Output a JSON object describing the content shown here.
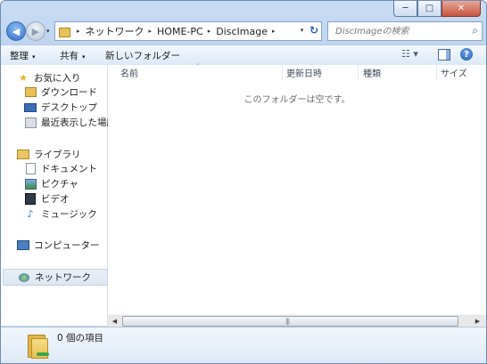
{
  "window": {
    "caption_min": "─",
    "caption_max": "□",
    "caption_close": "✕"
  },
  "nav": {
    "back_glyph": "◀",
    "forward_glyph": "▶",
    "dropdown_glyph": "▾"
  },
  "address": {
    "breadcrumbs": [
      "ネットワーク",
      "HOME-PC",
      "DiscImage"
    ],
    "separator": "▸",
    "dropdown_glyph": "▾",
    "refresh_glyph": "↻"
  },
  "search": {
    "placeholder": "DiscImageの検索",
    "icon": "search-icon"
  },
  "commands": {
    "organize": "整理",
    "share": "共有",
    "new_folder": "新しいフォルダー",
    "dropdown_glyph": "▾",
    "view_glyph": "☷ ▾",
    "help": "?"
  },
  "navpane": {
    "favorites": {
      "label": "お気に入り",
      "items": [
        "ダウンロード",
        "デスクトップ",
        "最近表示した場所"
      ]
    },
    "libraries": {
      "label": "ライブラリ",
      "items": [
        "ドキュメント",
        "ピクチャ",
        "ビデオ",
        "ミュージック"
      ]
    },
    "computer": "コンピューター",
    "network": "ネットワーク"
  },
  "columns": [
    "名前",
    "更新日時",
    "種類",
    "サイズ"
  ],
  "sort_indicator": "˄",
  "empty_message": "このフォルダーは空です。",
  "scrollbar": {
    "left": "◀",
    "right": "▶",
    "grip": "|||"
  },
  "details": {
    "item_count": "0 個の項目"
  },
  "colors": {
    "window_frame": "#bcd3ef",
    "selection": "#dde6f1",
    "accent": "#2c69c3"
  }
}
